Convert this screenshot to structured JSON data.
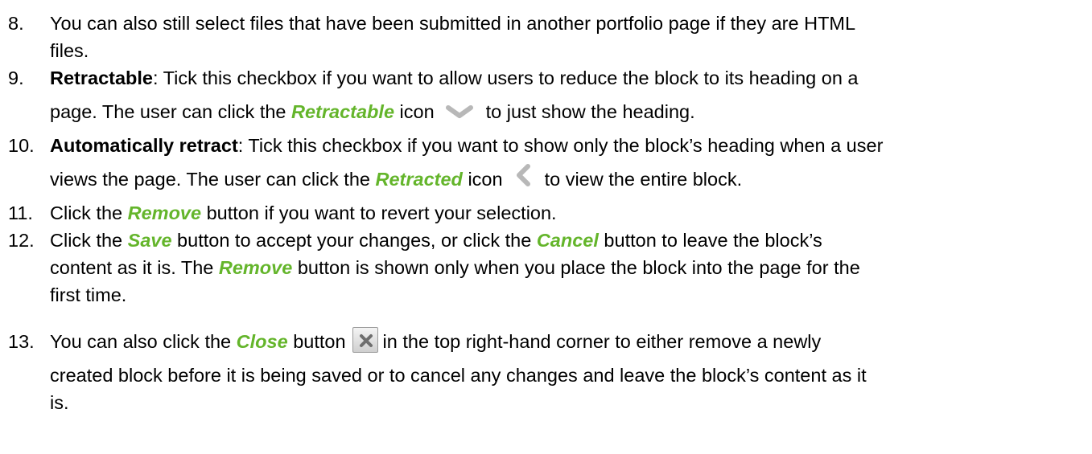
{
  "colors": {
    "highlight": "#64b52b",
    "text": "#000000"
  },
  "items": [
    {
      "number": "8.",
      "lines": [
        "You can also still select files that have been submitted in another portfolio page if they are HTML",
        "files."
      ]
    },
    {
      "number": "9.",
      "term": "Retractable",
      "line1_rest": ": Tick this checkbox if you want to allow users to reduce the block to its heading on a",
      "line2_before": "page. The user can click the ",
      "button_name": "Retractable",
      "line2_mid": " icon",
      "icon": "chevron-down-icon",
      "line2_after": "to just show the heading."
    },
    {
      "number": "10.",
      "term": "Automatically retract",
      "line1_rest": ": Tick this checkbox if you want to show only the block’s heading when a user",
      "line2_before": "views the page. The user can click the ",
      "button_name": "Retracted",
      "line2_mid": " icon",
      "icon": "chevron-left-icon",
      "line2_after": "to view the entire block."
    },
    {
      "number": "11.",
      "before": "Click the ",
      "button_name": "Remove",
      "after": " button if you want to revert your selection."
    },
    {
      "number": "12.",
      "line1_before": "Click the ",
      "save": "Save",
      "line1_mid": " button to accept your changes, or click the ",
      "cancel": "Cancel",
      "line1_after": " button to leave the block’s",
      "line2_before": "content as it is. The ",
      "remove": "Remove",
      "line2_after": " button is shown only when you place the block into the page for the",
      "line3": "first time."
    },
    {
      "number": "13.",
      "line1_before": "You can also click the ",
      "button_name": "Close",
      "line1_mid": " button",
      "icon": "close-icon",
      "line1_after": "in the top right-hand corner to either remove a newly",
      "line2": "created block before it is being saved or to cancel any changes and leave the block’s content as it",
      "line3": "is."
    }
  ]
}
